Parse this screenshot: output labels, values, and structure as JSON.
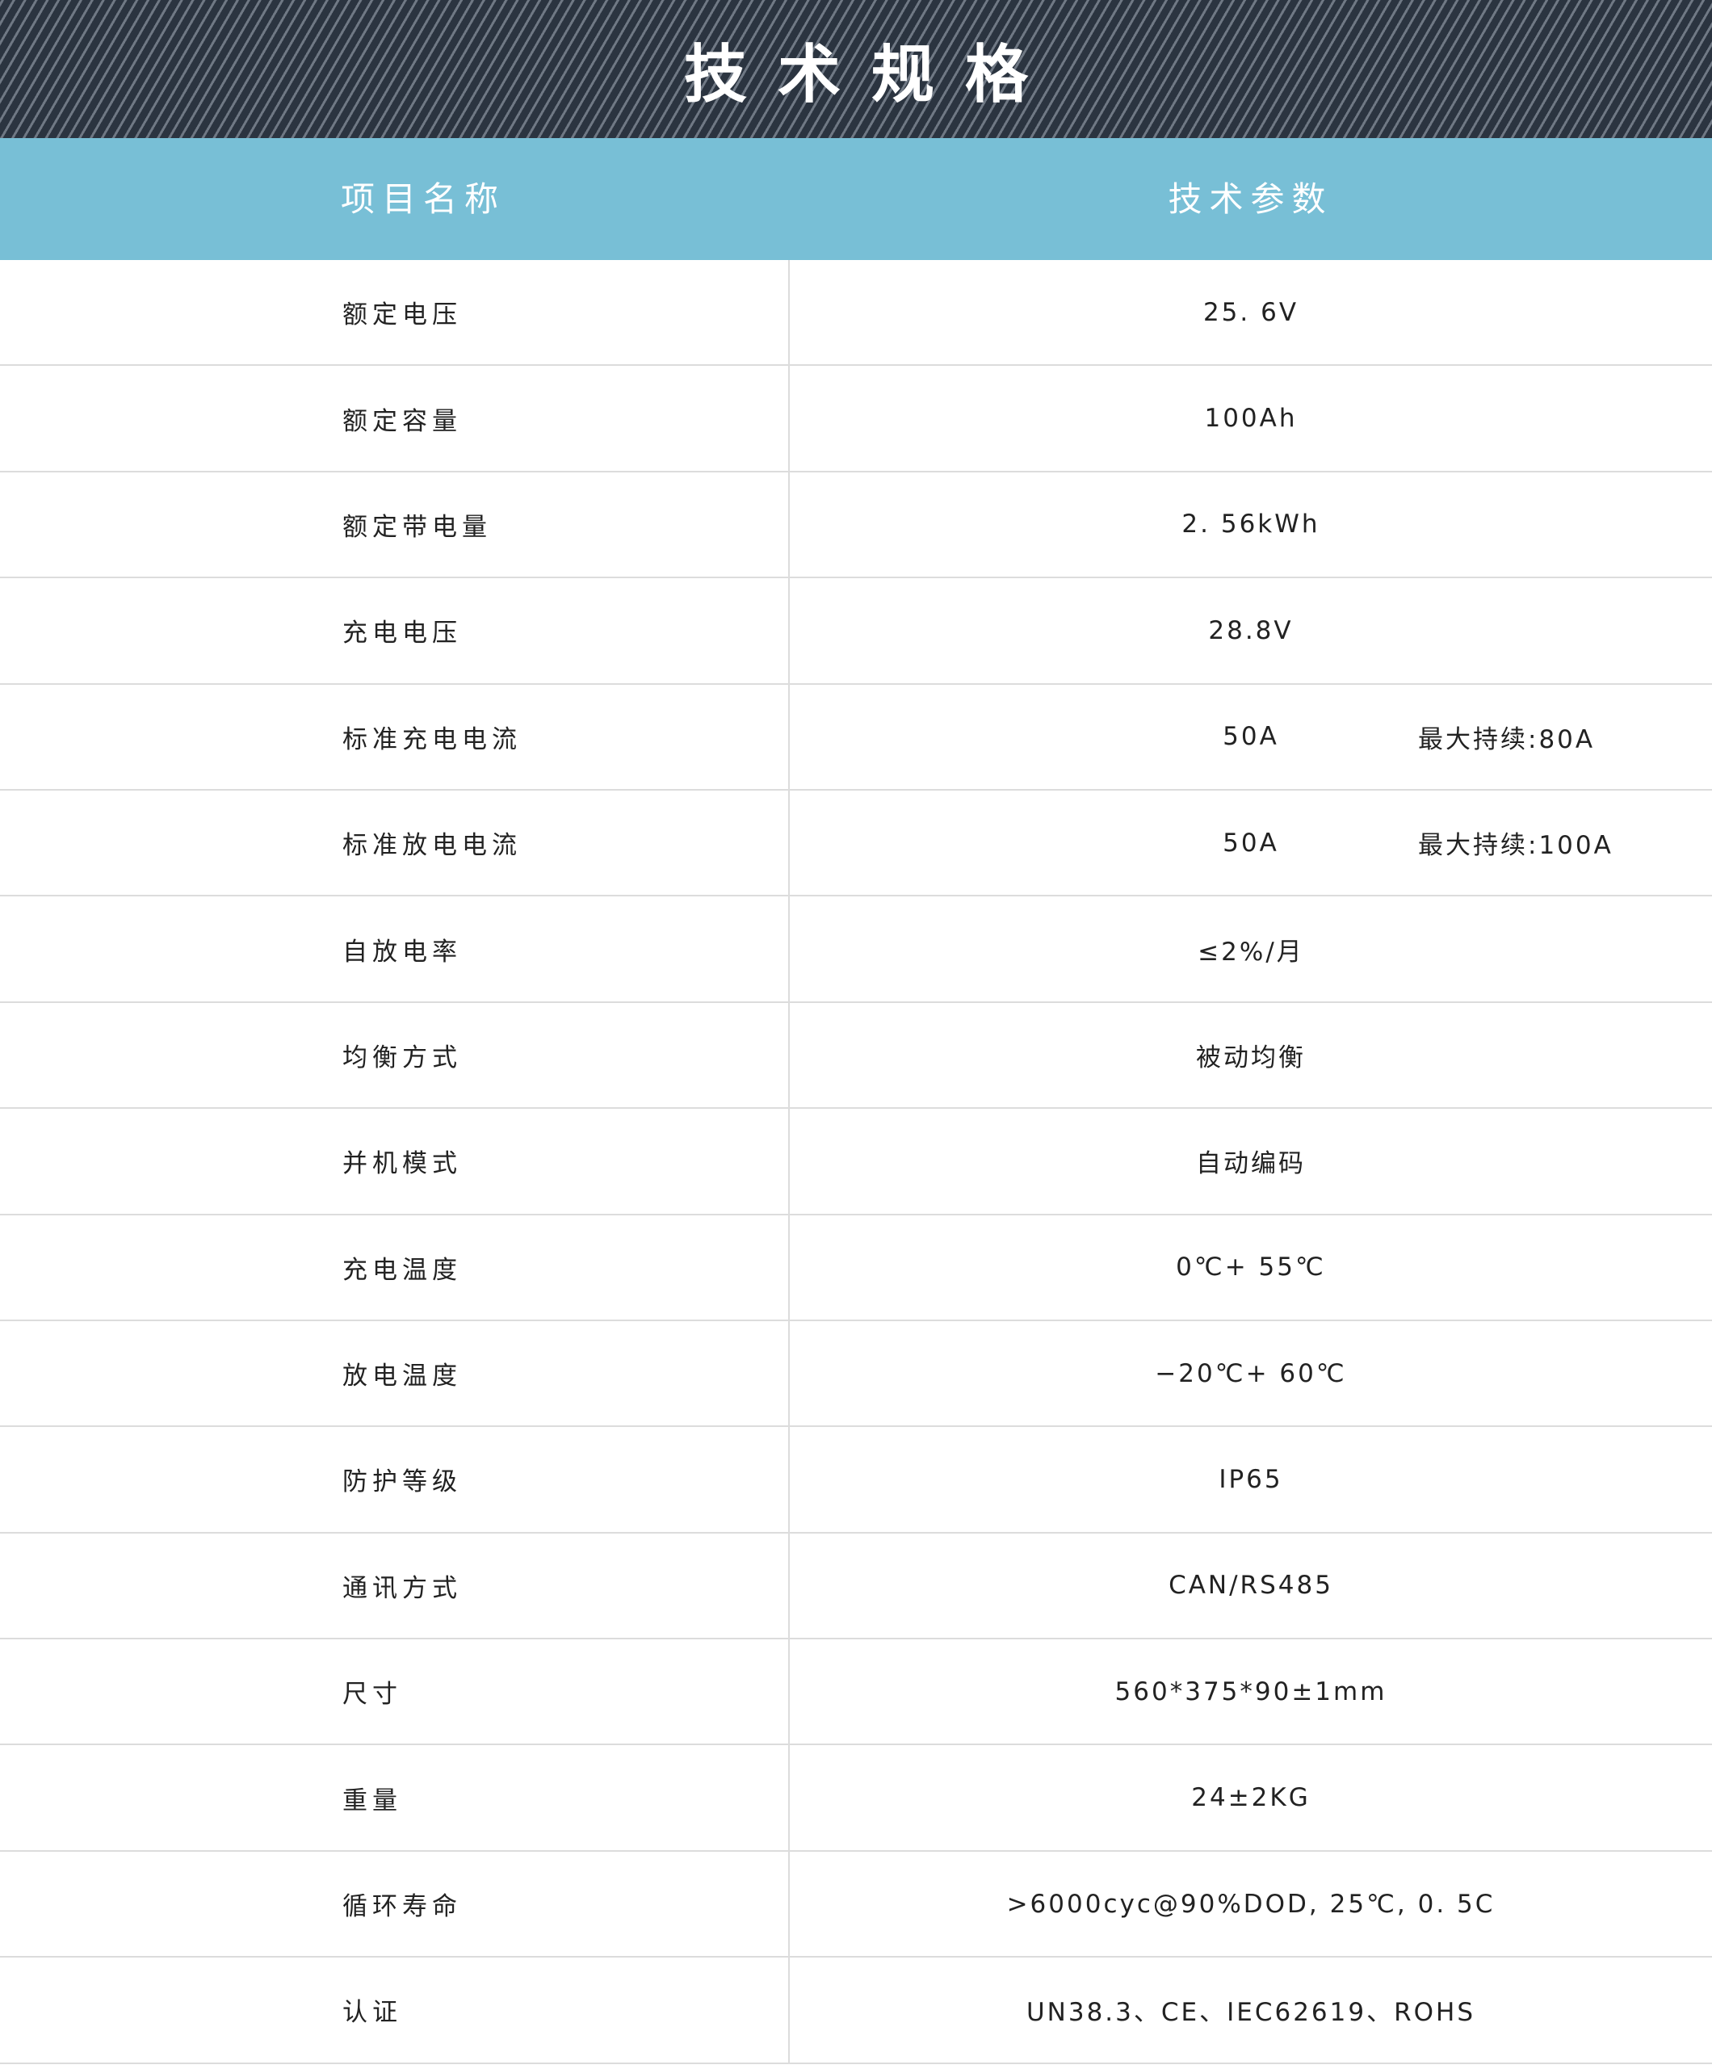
{
  "banner": {
    "title": "技术规格"
  },
  "header": {
    "col_name": "项目名称",
    "col_param": "技术参数"
  },
  "rows": [
    {
      "name": "额定电压",
      "value": "25. 6V",
      "extra": ""
    },
    {
      "name": "额定容量",
      "value": "100Ah",
      "extra": ""
    },
    {
      "name": "额定带电量",
      "value": "2. 56kWh",
      "extra": ""
    },
    {
      "name": "充电电压",
      "value": "28.8V",
      "extra": ""
    },
    {
      "name": "标准充电电流",
      "value": "50A",
      "extra": "最大持续:80A"
    },
    {
      "name": "标准放电电流",
      "value": "50A",
      "extra": "最大持续:100A"
    },
    {
      "name": "自放电率",
      "value": "≤2%/月",
      "extra": ""
    },
    {
      "name": "均衡方式",
      "value": "被动均衡",
      "extra": ""
    },
    {
      "name": "并机模式",
      "value": "自动编码",
      "extra": ""
    },
    {
      "name": "充电温度",
      "value": "0℃+ 55℃",
      "extra": ""
    },
    {
      "name": "放电温度",
      "value": "−20℃+ 60℃",
      "extra": ""
    },
    {
      "name": "防护等级",
      "value": "IP65",
      "extra": ""
    },
    {
      "name": "通讯方式",
      "value": "CAN/RS485",
      "extra": ""
    },
    {
      "name": "尺寸",
      "value": "560*375*90±1mm",
      "extra": ""
    },
    {
      "name": "重量",
      "value": "24±2KG",
      "extra": ""
    },
    {
      "name": "循环寿命",
      "value": ">6000cyc@90%DOD, 25℃, 0. 5C",
      "extra": ""
    },
    {
      "name": "认证",
      "value": "UN38.3、CE、IEC62619、ROHS",
      "extra": ""
    }
  ]
}
